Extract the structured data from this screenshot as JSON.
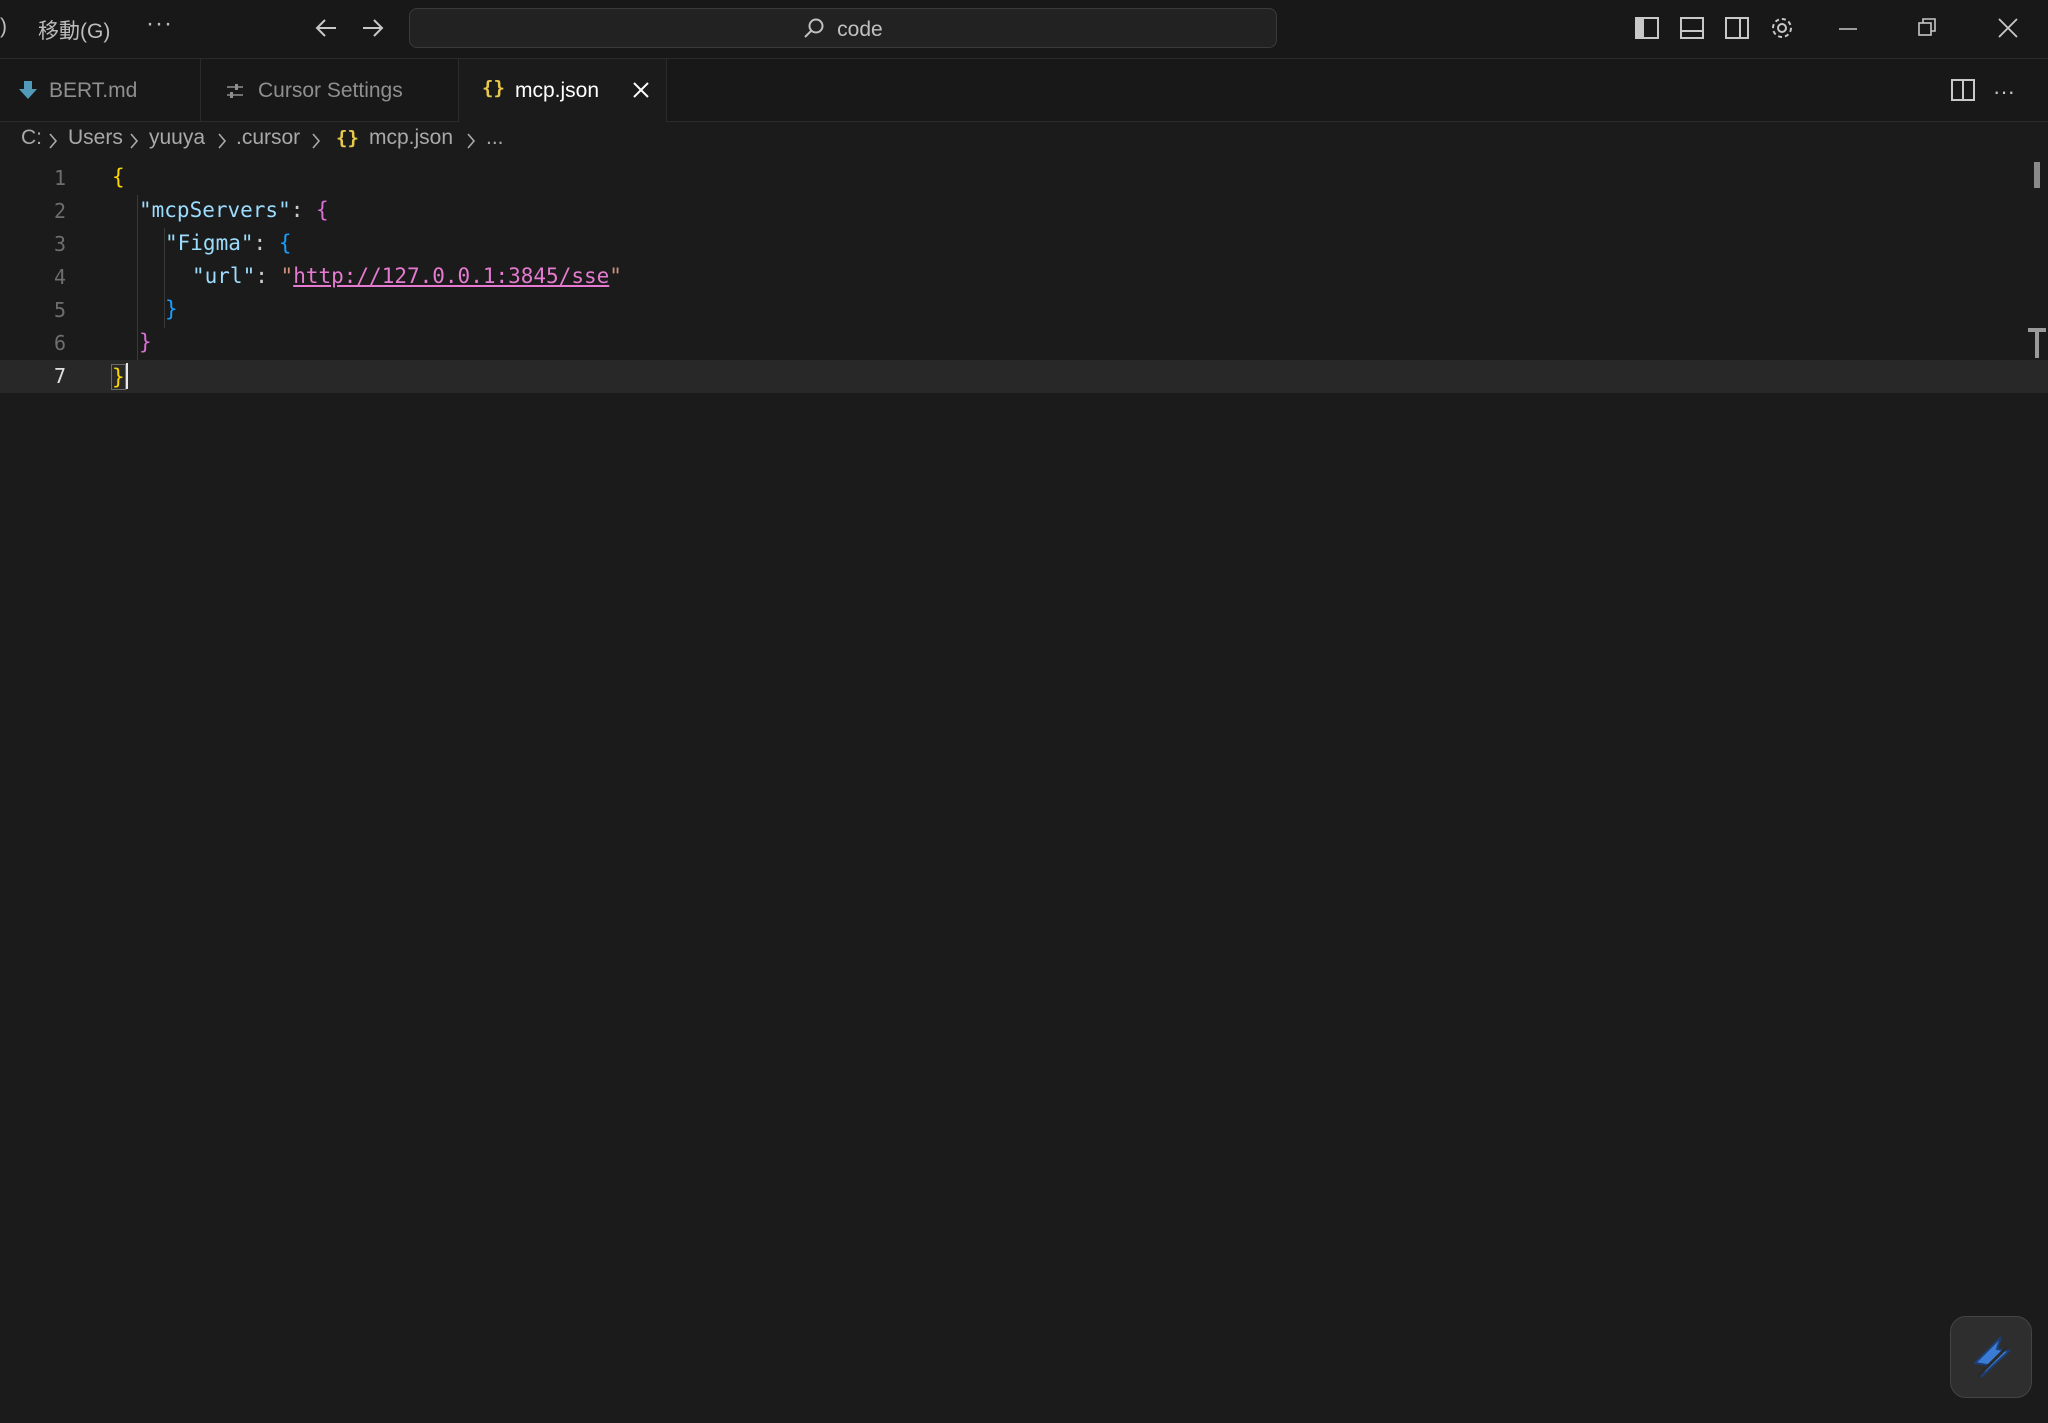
{
  "titlebar": {
    "menu_partial": ")",
    "menu_go": "移動(G)",
    "more": "···",
    "search_text": "code"
  },
  "tabs": [
    {
      "label": "BERT.md",
      "icon": "download-arrow-icon",
      "active": false
    },
    {
      "label": "Cursor Settings",
      "icon": "settings-sliders-icon",
      "active": false
    },
    {
      "label": "mcp.json",
      "icon": "json-braces-icon",
      "active": true
    }
  ],
  "breadcrumb": {
    "items": [
      "C:",
      "Users",
      "yuuya",
      ".cursor",
      "mcp.json",
      "..."
    ],
    "json_icon": "{}"
  },
  "editor": {
    "line_numbers": [
      "1",
      "2",
      "3",
      "4",
      "5",
      "6",
      "7"
    ],
    "current_line": "7",
    "tokens": {
      "brace_open_1": "{",
      "key_mcp": "\"mcpServers\"",
      "colon": ":",
      "brace_open_2": "{",
      "key_figma": "\"Figma\"",
      "brace_open_3": "{",
      "key_url": "\"url\"",
      "quote": "\"",
      "url_value": "http://127.0.0.1:3845/sse",
      "brace_close_3": "}",
      "brace_close_2": "}",
      "brace_close_1": "}"
    }
  },
  "colors": {
    "background": "#1b1b1b",
    "titlebar": "#181818",
    "key": "#9cdcfe",
    "string": "#ce9178",
    "brace_gold": "#ffd700",
    "brace_purple": "#da70d6",
    "brace_blue": "#179fff"
  }
}
